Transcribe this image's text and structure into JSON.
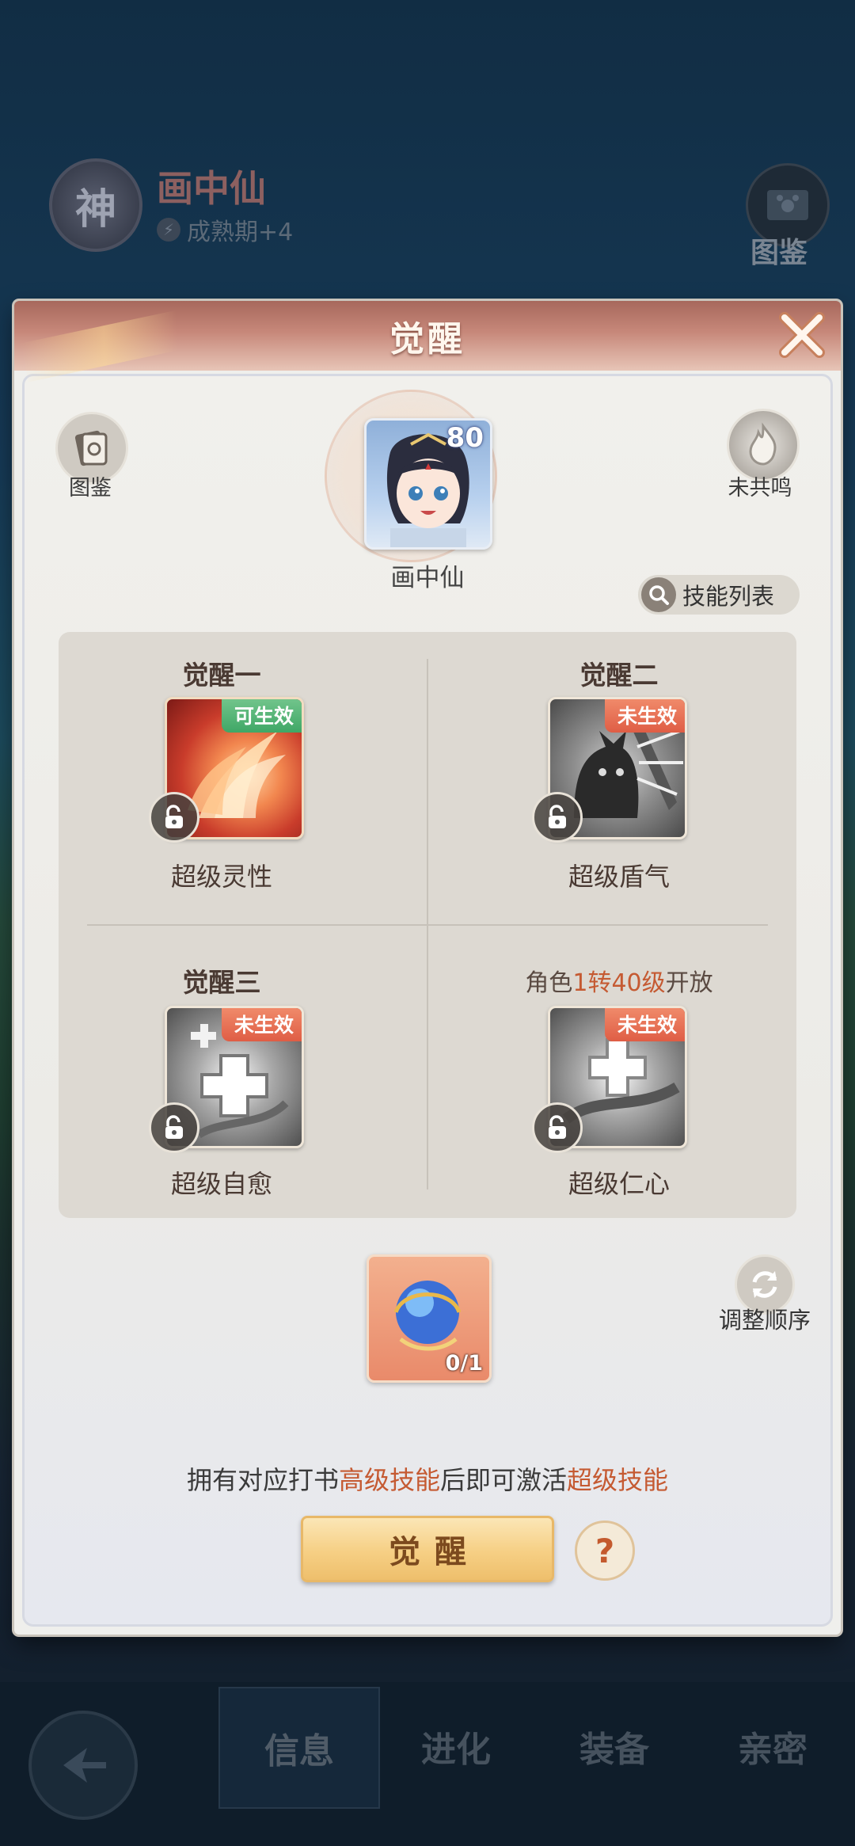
{
  "background": {
    "god_badge": "神",
    "character_name": "画中仙",
    "growth": "成熟期+4",
    "atlas_label": "图鉴"
  },
  "bottom_nav": {
    "tabs": [
      "信息",
      "进化",
      "装备",
      "亲密"
    ],
    "active": "信息"
  },
  "modal": {
    "title": "觉醒",
    "left_icon_label": "图鉴",
    "right_icon_label": "未共鸣",
    "character": {
      "name": "画中仙",
      "level": "80"
    },
    "skill_list_label": "技能列表",
    "slots": [
      {
        "title": "觉醒一",
        "tag": "可生效",
        "tag_color": "#3fa766",
        "skill": "超级灵性"
      },
      {
        "title": "觉醒二",
        "tag": "未生效",
        "tag_color": "#df5d45",
        "skill": "超级盾气"
      },
      {
        "title": "觉醒三",
        "tag": "未生效",
        "tag_color": "#df5d45",
        "skill": "超级自愈"
      },
      {
        "title_pre": "角色",
        "title_hl": "1转40级",
        "title_post": "开放",
        "tag": "未生效",
        "tag_color": "#df5d45",
        "skill": "超级仁心"
      }
    ],
    "item_count": "0/1",
    "reorder_label": "调整顺序",
    "hint": {
      "part1": "拥有对应打书",
      "hl1": "高级技能",
      "part2": "后即可激活",
      "hl2": "超级技能"
    },
    "awaken_button": "觉醒",
    "help_symbol": "?"
  }
}
